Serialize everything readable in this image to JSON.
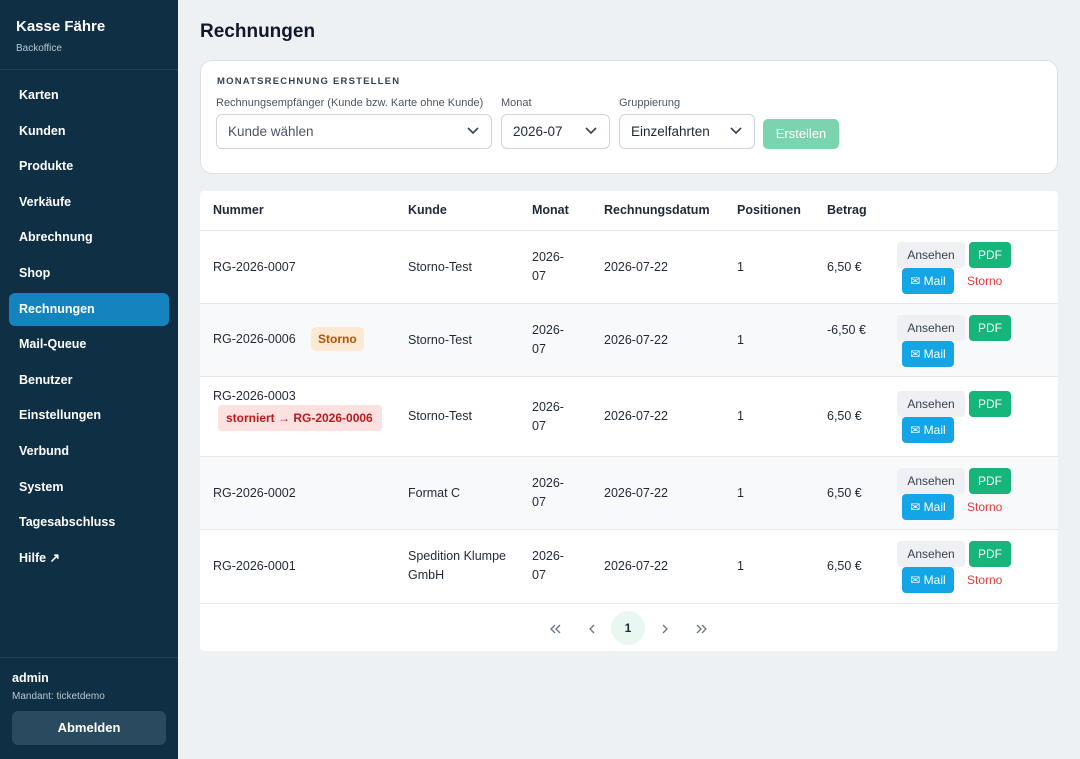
{
  "sidebar": {
    "title": "Kasse Fähre",
    "subtitle": "Backoffice",
    "items": [
      {
        "label": "Karten"
      },
      {
        "label": "Kunden"
      },
      {
        "label": "Produkte"
      },
      {
        "label": "Verkäufe"
      },
      {
        "label": "Abrechnung"
      },
      {
        "label": "Shop"
      },
      {
        "label": "Rechnungen",
        "active": true
      },
      {
        "label": "Mail-Queue"
      },
      {
        "label": "Benutzer"
      },
      {
        "label": "Einstellungen"
      },
      {
        "label": "Verbund"
      },
      {
        "label": "System"
      },
      {
        "label": "Tagesabschluss"
      },
      {
        "label": "Hilfe ↗"
      }
    ],
    "user": "admin",
    "tenant": "Mandant: ticketdemo",
    "logout_label": "Abmelden"
  },
  "page": {
    "title": "Rechnungen"
  },
  "create": {
    "section_title": "MONATSRECHNUNG ERSTELLEN",
    "recipient_label": "Rechnungsempfänger (Kunde bzw. Karte ohne Kunde)",
    "recipient_value": "Kunde wählen",
    "month_label": "Monat",
    "month_value": "2026-07",
    "grouping_label": "Gruppierung",
    "grouping_value": "Einzelfahrten",
    "submit_label": "Erstellen"
  },
  "table": {
    "headers": {
      "number": "Nummer",
      "customer": "Kunde",
      "month": "Monat",
      "date": "Rechnungsdatum",
      "positions": "Positionen",
      "amount": "Betrag"
    },
    "actions": {
      "view": "Ansehen",
      "pdf": "PDF",
      "mail": "✉ Mail",
      "storno": "Storno"
    },
    "rows": [
      {
        "number": "RG-2026-0007",
        "customer": "Storno-Test",
        "month": "2026-07",
        "date": "2026-07-22",
        "positions": "1",
        "amount": "6,50 €"
      },
      {
        "number": "RG-2026-0006",
        "badge": "Storno",
        "customer": "Storno-Test",
        "month": "2026-07",
        "date": "2026-07-22",
        "positions": "1",
        "amount": "-6,50 €"
      },
      {
        "number": "RG-2026-0003",
        "note": "storniert → RG-2026-0006",
        "customer": "Storno-Test",
        "month": "2026-07",
        "date": "2026-07-22",
        "positions": "1",
        "amount": "6,50 €"
      },
      {
        "number": "RG-2026-0002",
        "customer": "Format C",
        "month": "2026-07",
        "date": "2026-07-22",
        "positions": "1",
        "amount": "6,50 €"
      },
      {
        "number": "RG-2026-0001",
        "customer": "Spedition Klumpe GmbH",
        "month": "2026-07",
        "date": "2026-07-22",
        "positions": "1",
        "amount": "6,50 €"
      }
    ]
  },
  "pagination": {
    "current": "1"
  }
}
